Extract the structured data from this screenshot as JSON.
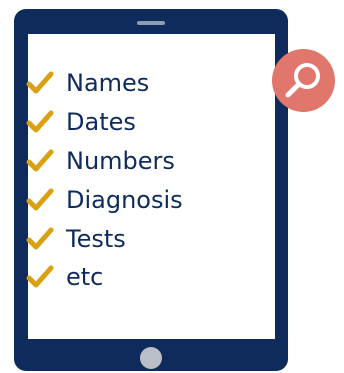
{
  "device": {
    "type": "tablet",
    "frame_color": "#0f2b5c",
    "screen_color": "#ffffff",
    "home_button_color": "#b9bec7"
  },
  "checklist": {
    "check_icon": "checkmark-icon",
    "check_color": "#d9a012",
    "items": [
      {
        "label": "Names"
      },
      {
        "label": "Dates"
      },
      {
        "label": "Numbers"
      },
      {
        "label": "Diagnosis"
      },
      {
        "label": "Tests"
      },
      {
        "label": "etc"
      }
    ]
  },
  "badge": {
    "icon": "magnifier-icon",
    "color": "#e0766c"
  }
}
